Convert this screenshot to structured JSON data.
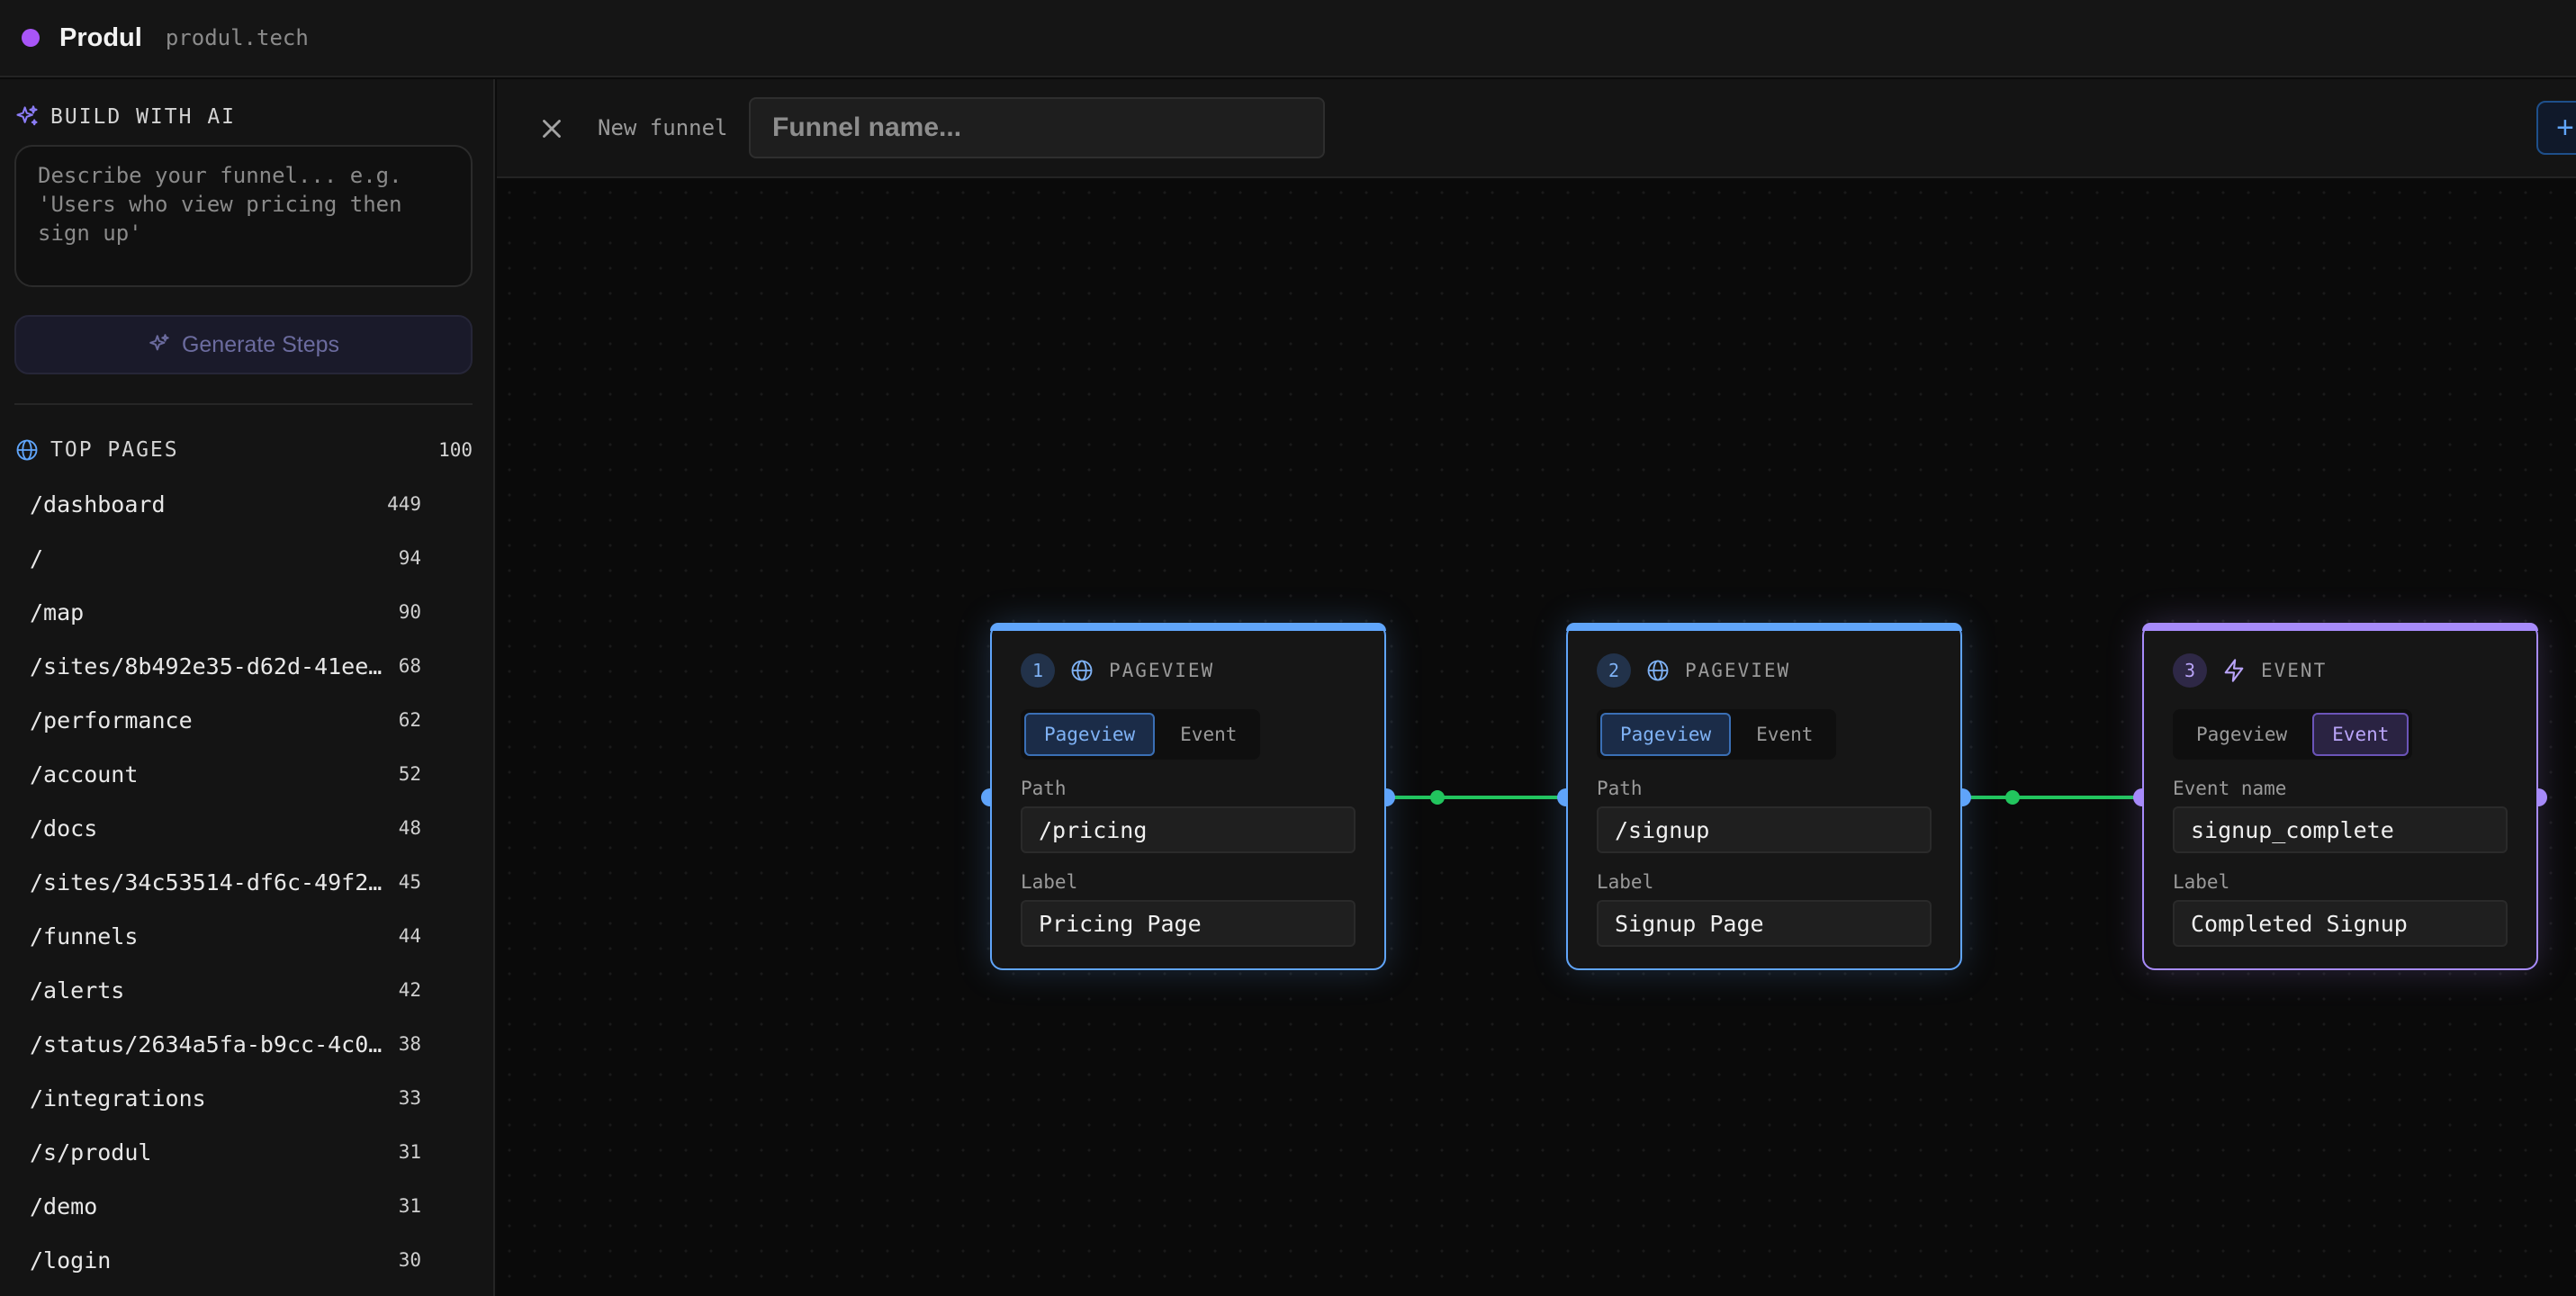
{
  "header": {
    "brand": "Produl",
    "domain": "produl.tech"
  },
  "sidebar": {
    "ai_title": "BUILD WITH AI",
    "ai_placeholder": "Describe your funnel... e.g. 'Users who view pricing then sign up'",
    "generate_label": "Generate Steps",
    "top_pages_title": "TOP PAGES",
    "top_pages_count": "100",
    "pages": [
      {
        "path": "/dashboard",
        "count": "449"
      },
      {
        "path": "/",
        "count": "94"
      },
      {
        "path": "/map",
        "count": "90"
      },
      {
        "path": "/sites/8b492e35-d62d-41ee-…",
        "count": "68"
      },
      {
        "path": "/performance",
        "count": "62"
      },
      {
        "path": "/account",
        "count": "52"
      },
      {
        "path": "/docs",
        "count": "48"
      },
      {
        "path": "/sites/34c53514-df6c-49f2-…",
        "count": "45"
      },
      {
        "path": "/funnels",
        "count": "44"
      },
      {
        "path": "/alerts",
        "count": "42"
      },
      {
        "path": "/status/2634a5fa-b9cc-4c01…",
        "count": "38"
      },
      {
        "path": "/integrations",
        "count": "33"
      },
      {
        "path": "/s/produl",
        "count": "31"
      },
      {
        "path": "/demo",
        "count": "31"
      },
      {
        "path": "/login",
        "count": "30"
      }
    ]
  },
  "editor": {
    "new_funnel_label": "New funnel",
    "name_placeholder": "Funnel name...",
    "add_label": "+"
  },
  "nodes": [
    {
      "num": "1",
      "type": "PAGEVIEW",
      "tab_pageview": "Pageview",
      "tab_event": "Event",
      "field1_label": "Path",
      "field1_value": "/pricing",
      "field2_label": "Label",
      "field2_value": "Pricing Page"
    },
    {
      "num": "2",
      "type": "PAGEVIEW",
      "tab_pageview": "Pageview",
      "tab_event": "Event",
      "field1_label": "Path",
      "field1_value": "/signup",
      "field2_label": "Label",
      "field2_value": "Signup Page"
    },
    {
      "num": "3",
      "type": "EVENT",
      "tab_pageview": "Pageview",
      "tab_event": "Event",
      "field1_label": "Event name",
      "field1_value": "signup_complete",
      "field2_label": "Label",
      "field2_value": "Completed Signup"
    }
  ],
  "colors": {
    "accent_blue": "#60a5fa",
    "accent_purple": "#a78bfa",
    "connector_green": "#22c55e",
    "brand_dot": "#a855f7"
  }
}
